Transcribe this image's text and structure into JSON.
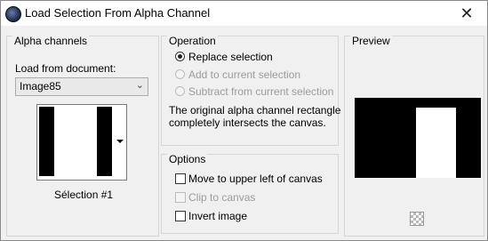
{
  "window": {
    "title": "Load Selection From Alpha Channel",
    "close_label": "✕"
  },
  "alpha_channels": {
    "group_title": "Alpha channels",
    "load_from_label": "Load from document:",
    "document_value": "Image85",
    "selection_name": "Sélection #1"
  },
  "operation": {
    "group_title": "Operation",
    "options": [
      {
        "label": "Replace selection",
        "selected": true,
        "enabled": true
      },
      {
        "label": "Add to current selection",
        "selected": false,
        "enabled": false
      },
      {
        "label": "Subtract from current selection",
        "selected": false,
        "enabled": false
      }
    ],
    "info_line1": "The original alpha channel rectangle",
    "info_line2": "completely intersects the canvas."
  },
  "options_panel": {
    "group_title": "Options",
    "items": [
      {
        "label": "Move to upper left of canvas",
        "checked": false,
        "enabled": true
      },
      {
        "label": "Clip to canvas",
        "checked": false,
        "enabled": false
      },
      {
        "label": "Invert image",
        "checked": false,
        "enabled": true
      }
    ]
  },
  "preview": {
    "group_title": "Preview"
  },
  "colors": {
    "accent": "#000000",
    "disabled": "#9c9c9c"
  },
  "icons": [
    "app-icon",
    "close-icon",
    "dropdown-arrow-icon",
    "transparent-background-icon"
  ]
}
